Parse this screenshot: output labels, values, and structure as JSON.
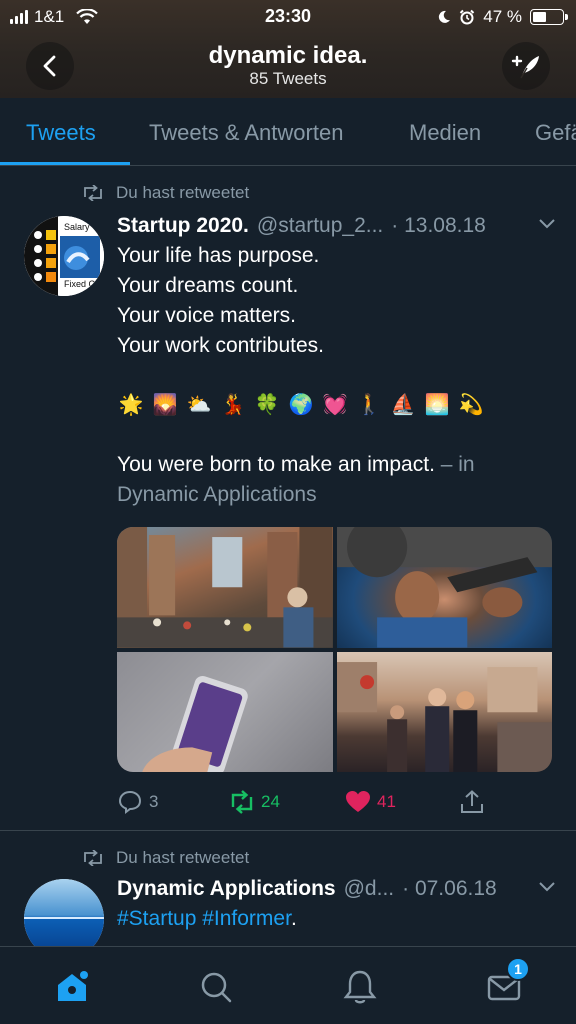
{
  "status_bar": {
    "carrier": "1&1",
    "time": "23:30",
    "battery_percent": "47 %",
    "battery_level": 0.47
  },
  "header": {
    "title": "dynamic idea.",
    "subtitle": "85 Tweets",
    "back_icon": "chevron-left-icon",
    "compose_icon": "compose-feather-icon"
  },
  "tabs": [
    {
      "label": "Tweets",
      "active": true
    },
    {
      "label": "Tweets & Antworten",
      "active": false
    },
    {
      "label": "Medien",
      "active": false
    },
    {
      "label": "Gefä",
      "active": false
    }
  ],
  "tweets": [
    {
      "retweet_label": "Du hast retweetet",
      "name": "Startup 2020.",
      "handle": "@startup_2...",
      "date": "· 13.08.18",
      "avatar_labels": {
        "top": "Salary",
        "bottom": "Fixed C"
      },
      "text_lines": [
        "Your life has purpose.",
        "Your dreams count.",
        "Your voice matters.",
        "Your work contributes."
      ],
      "emojis": [
        "🌟",
        "🌄",
        "⛅",
        "💃",
        "🍀",
        "🌍",
        "💓",
        "🚶",
        "⛵",
        "🌅",
        "💫"
      ],
      "footer_text": "You were born to make an impact.",
      "footer_muted_prefix": "– in",
      "footer_muted_line": "Dynamic Applications",
      "replies": "3",
      "retweets": "24",
      "likes": "41"
    },
    {
      "retweet_label": "Du hast retweetet",
      "name": "Dynamic Applications",
      "handle": "@d...",
      "date": "· 07.06.18",
      "hashtags": "#Startup #Informer",
      "hashtags_suffix": "."
    }
  ],
  "bottom_nav": {
    "items": [
      "home-icon",
      "search-icon",
      "notifications-bell-icon",
      "messages-envelope-icon"
    ],
    "messages_badge": "1"
  },
  "colors": {
    "background": "#15202b",
    "accent": "#1da1f2",
    "muted": "#8899a6",
    "retweet_green": "#17bf63",
    "like_red": "#e0245e"
  }
}
